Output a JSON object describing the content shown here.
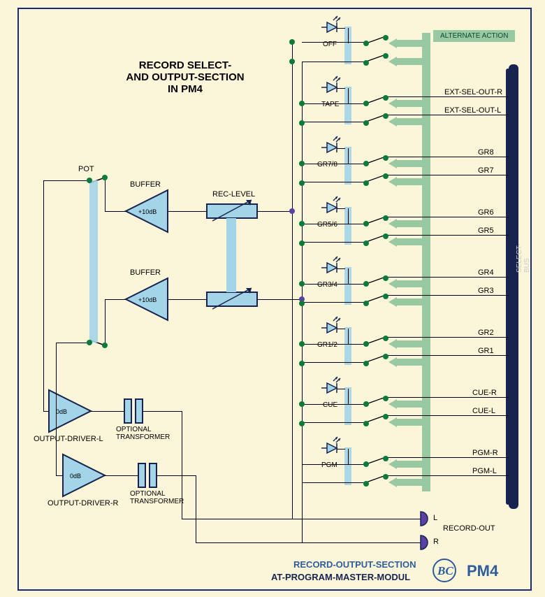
{
  "title": {
    "line1": "RECORD SELECT-",
    "line2": "AND OUTPUT-SECTION",
    "line3": "IN PM4"
  },
  "alternate_action": "ALTERNATE ACTION",
  "select_bus": "SELECT-BUS",
  "footer": {
    "line1": "RECORD-OUTPUT-SECTION",
    "line2": "AT-PROGRAM-MASTER-MODUL",
    "product": "PM4"
  },
  "left_chain": {
    "pot": "POT",
    "buffer_label": "BUFFER",
    "buffer_gain": "+10dB",
    "rec_level": "REC-LEVEL",
    "driver_l": "OUTPUT-DRIVER-L",
    "driver_r": "OUTPUT-DRIVER-R",
    "driver_gain": "0dB",
    "transformer": "OPTIONAL\nTRANSFORMER"
  },
  "record_out": {
    "label": "RECORD-OUT",
    "l": "L",
    "r": "R"
  },
  "switch_groups": [
    {
      "label": "OFF",
      "sig_top": "",
      "sig_bot": ""
    },
    {
      "label": "TAPE",
      "sig_top": "EXT-SEL-OUT-R",
      "sig_bot": "EXT-SEL-OUT-L"
    },
    {
      "label": "GR7/8",
      "sig_top": "GR8",
      "sig_bot": "GR7"
    },
    {
      "label": "GR5/6",
      "sig_top": "GR6",
      "sig_bot": "GR5"
    },
    {
      "label": "GR3/4",
      "sig_top": "GR4",
      "sig_bot": "GR3"
    },
    {
      "label": "GR1/2",
      "sig_top": "GR2",
      "sig_bot": "GR1"
    },
    {
      "label": "CUE",
      "sig_top": "CUE-R",
      "sig_bot": "CUE-L"
    },
    {
      "label": "PGM",
      "sig_top": "PGM-R",
      "sig_bot": "PGM-L"
    }
  ]
}
